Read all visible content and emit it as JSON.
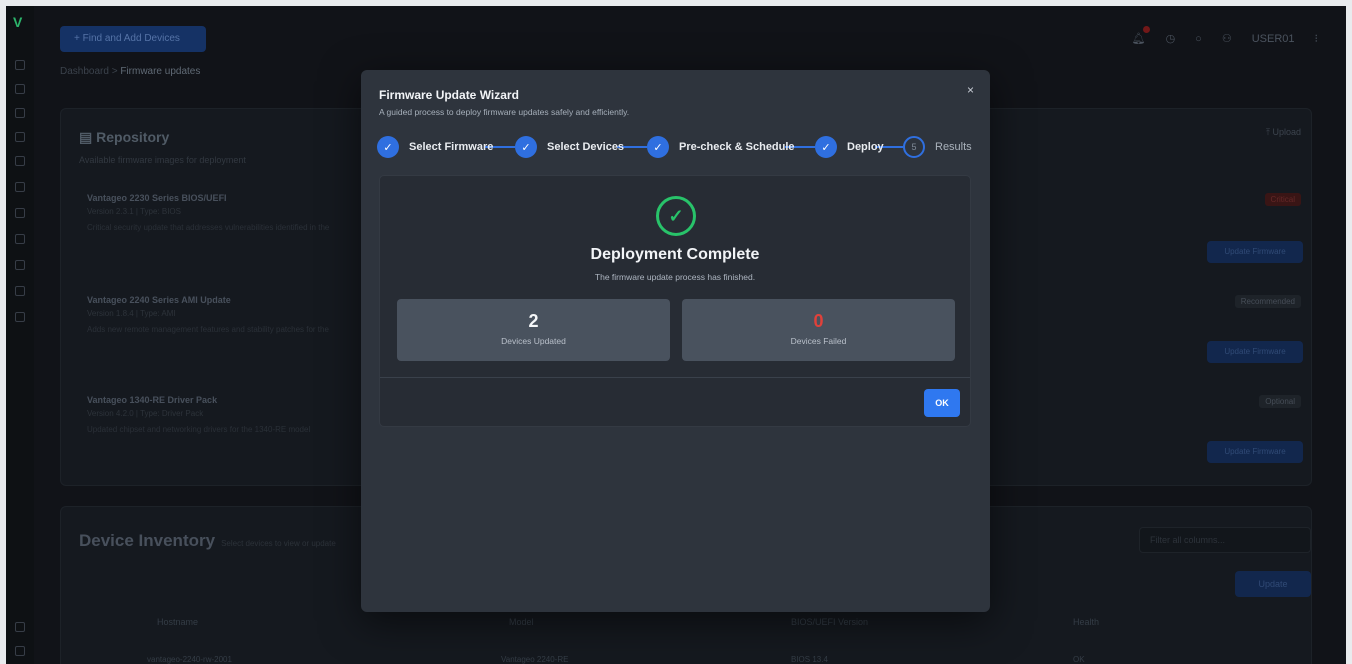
{
  "background": {
    "add_devices_button": "+ Find and Add Devices",
    "breadcrumb": {
      "root": "Dashboard",
      "separator": ">",
      "current": "Firmware updates"
    },
    "user": "USER01",
    "repository": {
      "title": "Repository",
      "subtitle": "Available firmware images for deployment",
      "upload_label": "Upload",
      "items": [
        {
          "name": "Vantageo 2230 Series BIOS/UEFI",
          "meta": "Version 2.3.1 | Type: BIOS",
          "desc": "Critical security update that addresses vulnerabilities identified in the",
          "tag": "Critical",
          "button": "Update Firmware"
        },
        {
          "name": "Vantageo 2240 Series AMI Update",
          "meta": "Version 1.8.4 | Type: AMI",
          "desc": "Adds new remote management features and stability patches for the",
          "tag": "Recommended",
          "button": "Update Firmware"
        },
        {
          "name": "Vantageo 1340-RE Driver Pack",
          "meta": "Version 4.2.0 | Type: Driver Pack",
          "desc": "Updated chipset and networking drivers for the 1340-RE model",
          "tag": "Optional",
          "button": "Update Firmware"
        }
      ]
    },
    "inventory": {
      "title": "Device Inventory",
      "subtitle": "Select devices to view or update",
      "filter_placeholder": "Filter all columns...",
      "update_button": "Update",
      "columns": [
        "Hostname",
        "Model",
        "BIOS/UEFI Version",
        "Health"
      ],
      "first_row": {
        "hostname": "vantageo-2240-rw-2001",
        "model": "Vantageo 2240-RE",
        "bios": "BIOS 13.4",
        "health": "OK"
      }
    }
  },
  "modal": {
    "title": "Firmware Update Wizard",
    "subtitle": "A guided process to deploy firmware updates safely and efficiently.",
    "close_glyph": "×",
    "steps": [
      {
        "label": "Select Firmware",
        "status": "complete"
      },
      {
        "label": "Select Devices",
        "status": "complete"
      },
      {
        "label": "Pre-check & Schedule",
        "status": "complete"
      },
      {
        "label": "Deploy",
        "status": "complete"
      },
      {
        "label": "Results",
        "status": "current",
        "number": "5"
      }
    ],
    "check_glyph": "✓",
    "result": {
      "heading": "Deployment Complete",
      "description": "The firmware update process has finished.",
      "updated_count": "2",
      "updated_label": "Devices Updated",
      "failed_count": "0",
      "failed_label": "Devices Failed"
    },
    "ok_button": "OK"
  },
  "colors": {
    "accent": "#2f78f0",
    "success": "#28c36a",
    "danger": "#e0413a",
    "modal_bg": "#2e343d"
  }
}
